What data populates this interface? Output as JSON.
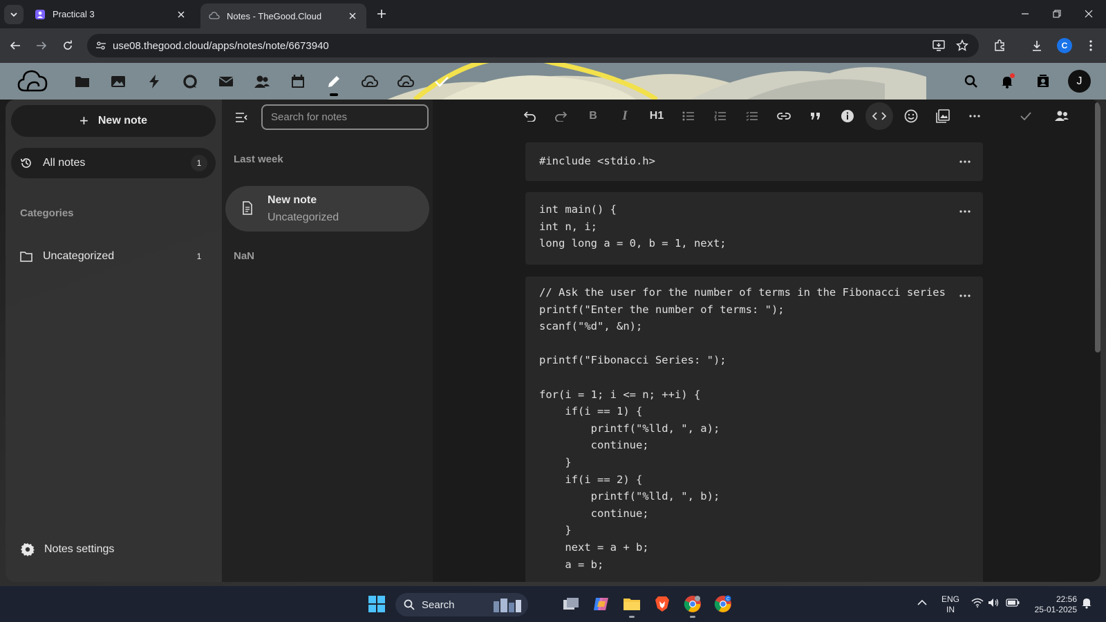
{
  "browser": {
    "tabs": [
      {
        "title": "Practical 3",
        "favicon": "teams-icon",
        "active": false
      },
      {
        "title": "Notes - TheGood.Cloud",
        "favicon": "cloud-icon",
        "active": true
      }
    ],
    "url": "use08.thegood.cloud/apps/notes/note/6673940",
    "profile_initial": "C"
  },
  "header": {
    "apps": [
      "files-icon",
      "photos-icon",
      "activity-icon",
      "talk-icon",
      "mail-icon",
      "contacts-icon",
      "calendar-icon",
      "notes-icon",
      "cloud-icon",
      "cloud-alt-icon",
      "tasks-icon"
    ],
    "active_app": "notes-icon",
    "avatar_initial": "J"
  },
  "navigation": {
    "new_note_label": "New note",
    "all_notes_label": "All notes",
    "all_notes_count": "1",
    "categories_heading": "Categories",
    "category_label": "Uncategorized",
    "category_count": "1",
    "settings_label": "Notes settings"
  },
  "note_list": {
    "search_placeholder": "Search for notes",
    "group_last_week": "Last week",
    "note_title": "New note",
    "note_category": "Uncategorized",
    "group_nan": "NaN"
  },
  "editor": {
    "toolbar": [
      "undo",
      "redo",
      "bold",
      "italic",
      "H1",
      "bullet-list",
      "ordered-list",
      "task-list",
      "link",
      "blockquote",
      "callout",
      "code-block",
      "emoji",
      "image",
      "more",
      "saved",
      "share"
    ],
    "heading_label": "H1",
    "blocks": [
      "#include <stdio.h>",
      "int main() {\nint n, i;\nlong long a = 0, b = 1, next;",
      "// Ask the user for the number of terms in the Fibonacci series\nprintf(\"Enter the number of terms: \");\nscanf(\"%d\", &n);\n\nprintf(\"Fibonacci Series: \");\n\nfor(i = 1; i <= n; ++i) {\n    if(i == 1) {\n        printf(\"%lld, \", a);\n        continue;\n    }\n    if(i == 2) {\n        printf(\"%lld, \", b);\n        continue;\n    }\n    next = a + b;\n    a = b;"
    ]
  },
  "taskbar": {
    "search_label": "Search",
    "lang_line1": "ENG",
    "lang_line2": "IN",
    "time": "22:56",
    "date": "25-01-2025",
    "chrome_profile_badge": "C"
  }
}
